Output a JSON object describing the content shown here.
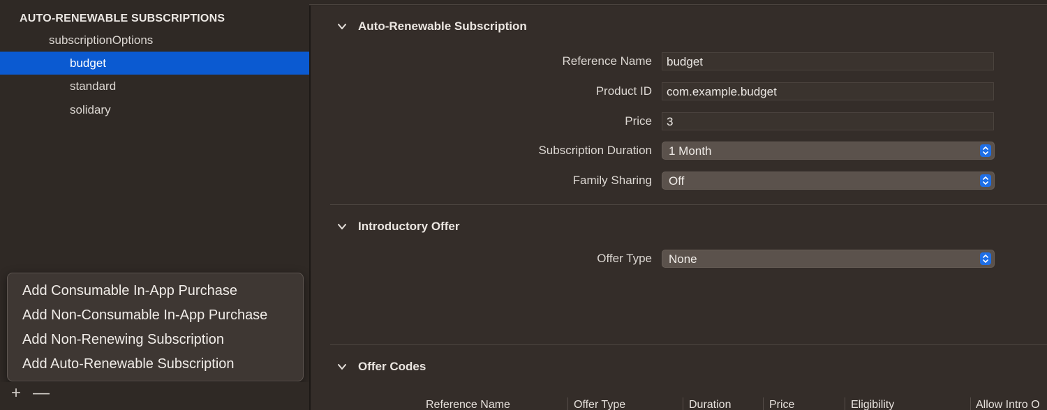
{
  "sidebar": {
    "group_header": "AUTO-RENEWABLE SUBSCRIPTIONS",
    "group_name": "subscriptionOptions",
    "items": [
      {
        "label": "budget",
        "selected": true
      },
      {
        "label": "standard",
        "selected": false
      },
      {
        "label": "solidary",
        "selected": false
      }
    ]
  },
  "context_menu": {
    "items": [
      {
        "label": "Add Consumable In-App Purchase"
      },
      {
        "label": "Add Non-Consumable In-App Purchase"
      },
      {
        "label": "Add Non-Renewing Subscription"
      },
      {
        "label": "Add Auto-Renewable Subscription"
      }
    ]
  },
  "bottom_bar": {
    "add_icon": "plus-icon",
    "remove_icon": "minus-icon"
  },
  "sections": {
    "auto_renewable": {
      "title": "Auto-Renewable Subscription",
      "reference_name_label": "Reference Name",
      "reference_name_value": "budget",
      "product_id_label": "Product ID",
      "product_id_value": "com.example.budget",
      "price_label": "Price",
      "price_value": "3",
      "duration_label": "Subscription Duration",
      "duration_value": "1 Month",
      "family_sharing_label": "Family Sharing",
      "family_sharing_value": "Off"
    },
    "introductory_offer": {
      "title": "Introductory Offer",
      "offer_type_label": "Offer Type",
      "offer_type_value": "None"
    },
    "offer_codes": {
      "title": "Offer Codes",
      "columns": [
        "Reference Name",
        "Offer Type",
        "Duration",
        "Price",
        "Eligibility",
        "Allow Intro O"
      ]
    }
  },
  "colors": {
    "selection": "#0b5ad1",
    "background": "#2f2925",
    "stepper_accent": "#1f6fe6"
  }
}
